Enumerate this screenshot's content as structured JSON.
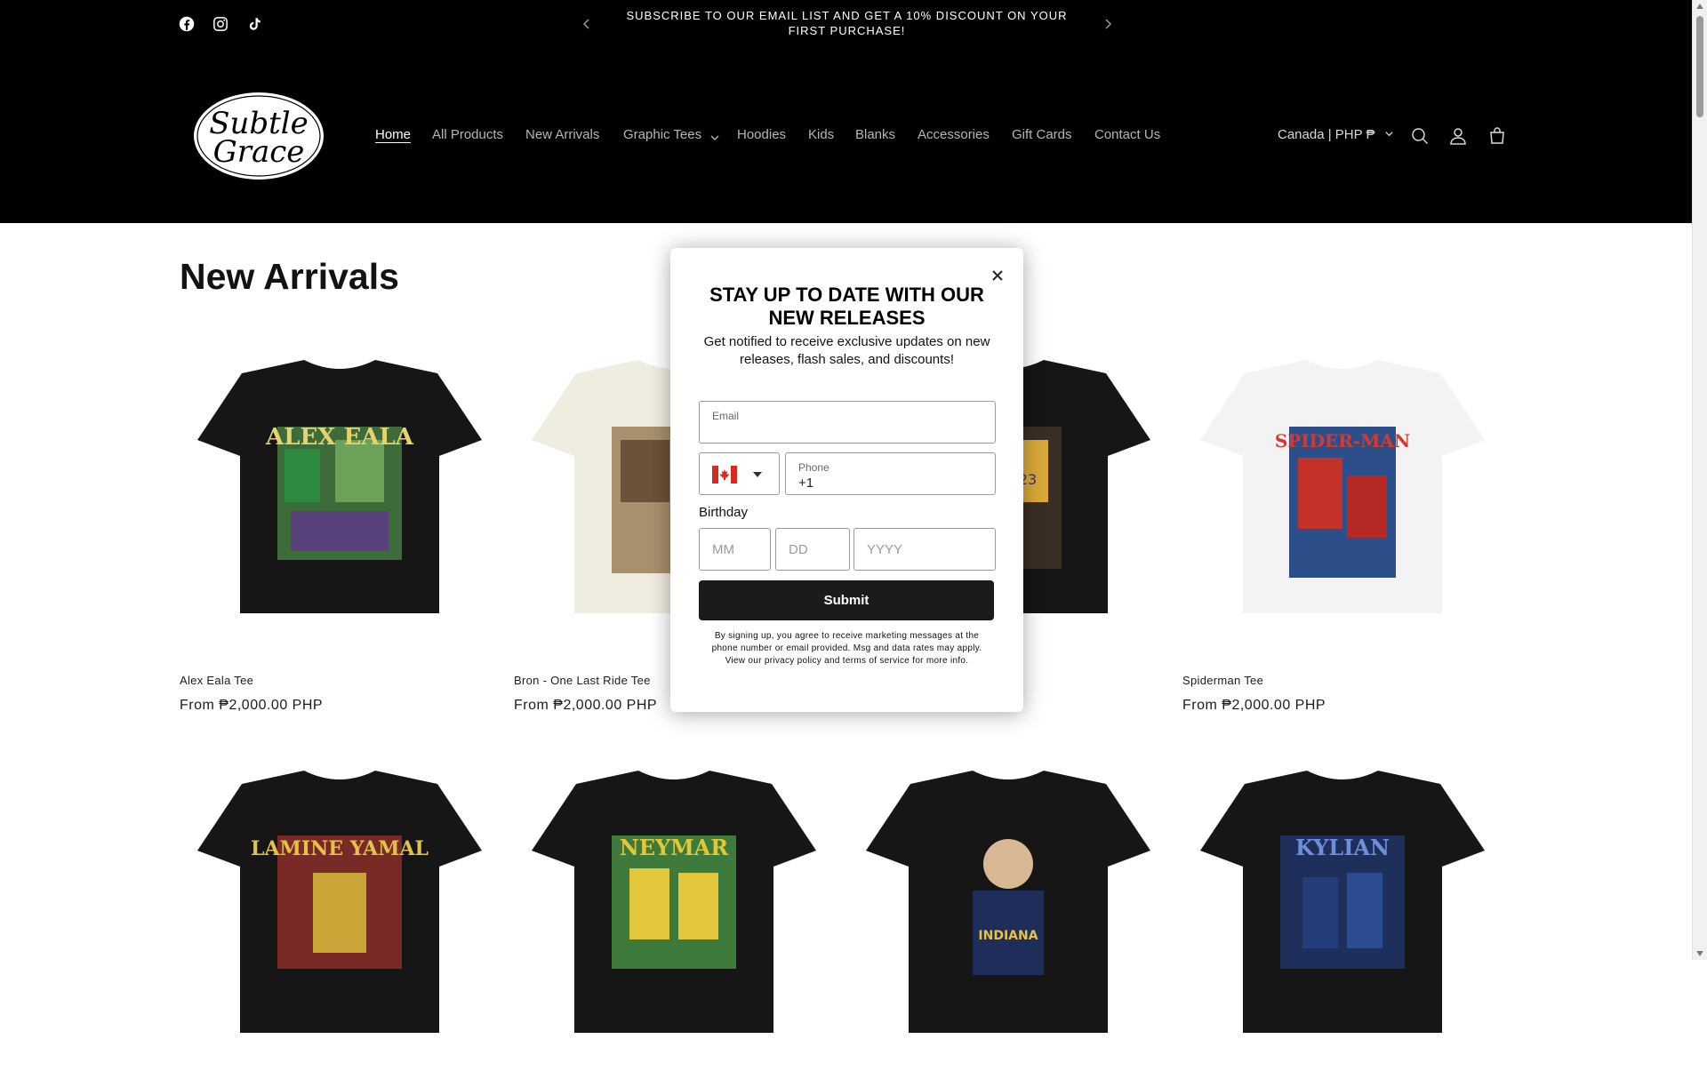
{
  "announcement": {
    "text": "SUBSCRIBE TO OUR EMAIL LIST AND GET A 10% DISCOUNT ON YOUR FIRST PURCHASE!",
    "social": [
      "facebook-icon",
      "instagram-icon",
      "tiktok-icon"
    ]
  },
  "header": {
    "logo_text": [
      "Subtle",
      "Grace"
    ],
    "nav": [
      {
        "label": "Home",
        "active": true
      },
      {
        "label": "All Products"
      },
      {
        "label": "New Arrivals"
      },
      {
        "label": "Graphic Tees",
        "dropdown": true
      },
      {
        "label": "Hoodies"
      },
      {
        "label": "Kids"
      },
      {
        "label": "Blanks"
      },
      {
        "label": "Accessories"
      },
      {
        "label": "Gift Cards"
      },
      {
        "label": "Contact Us"
      }
    ],
    "country": "Canada | PHP ₱",
    "icons": [
      "search-icon",
      "account-icon",
      "cart-icon"
    ]
  },
  "main": {
    "title": "New Arrivals",
    "products": [
      {
        "title": "Alex Eala Tee",
        "price": "From ₱2,000.00 PHP",
        "shirt_color": "#161616",
        "art": "ALEX EALA"
      },
      {
        "title": "Bron - One Last Ride Tee",
        "price": "From ₱2,000.00 PHP",
        "shirt_color": "#efece0",
        "art": ""
      },
      {
        "title": "",
        "price": "",
        "shirt_color": "#161616",
        "art": ""
      },
      {
        "title": "Spiderman Tee",
        "price": "From ₱2,000.00 PHP",
        "shirt_color": "#f3f3f3",
        "art": "SPIDER-MAN"
      },
      {
        "title": "",
        "price": "",
        "shirt_color": "#161616",
        "art": "LAMINE YAMAL"
      },
      {
        "title": "",
        "price": "",
        "shirt_color": "#161616",
        "art": "NEYMAR"
      },
      {
        "title": "",
        "price": "",
        "shirt_color": "#161616",
        "art": "INDIANA"
      },
      {
        "title": "",
        "price": "",
        "shirt_color": "#161616",
        "art": "KYLIAN"
      }
    ]
  },
  "modal": {
    "title": "STAY UP TO DATE WITH OUR NEW RELEASES",
    "subtitle": "Get notified to receive exclusive updates on new releases, flash sales, and discounts!",
    "email_label": "Email",
    "email_value": "",
    "phone_label": "Phone",
    "phone_value": "+1",
    "birthday_label": "Birthday",
    "mm_placeholder": "MM",
    "dd_placeholder": "DD",
    "yyyy_placeholder": "YYYY",
    "submit_label": "Submit",
    "disclaimer": "By signing up, you agree to receive marketing messages at the phone number or email provided. Msg and data rates may apply. View our privacy policy and terms of service for more info."
  },
  "colors": {
    "header_bg": "#000000",
    "button_bg": "#1b1b1b",
    "nav_inactive": "#b5b5b5"
  }
}
